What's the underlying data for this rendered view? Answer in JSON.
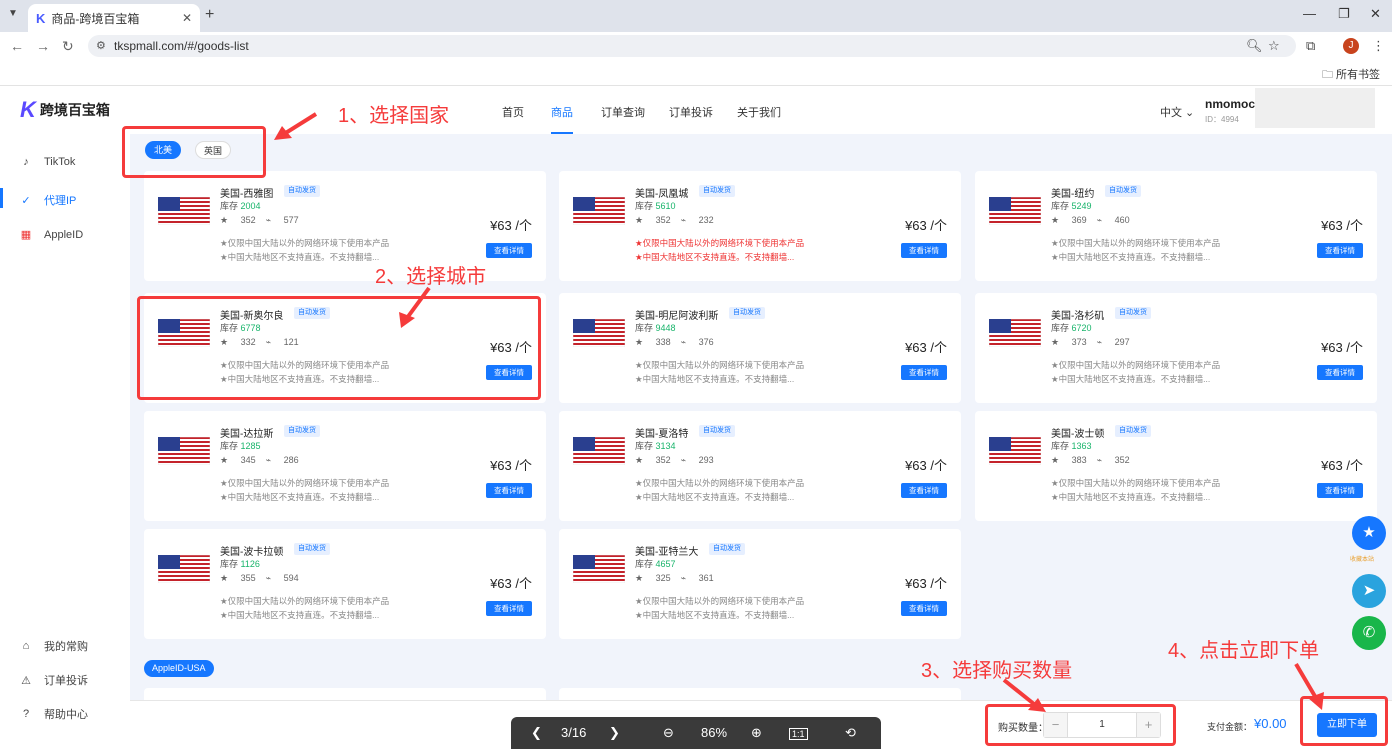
{
  "browser": {
    "tab_title": "商品-跨境百宝箱",
    "url": "tkspmall.com/#/goods-list",
    "bookmarks_label": "所有书签",
    "profile_initial": "J"
  },
  "header": {
    "brand": "跨境百宝箱",
    "nav": [
      "首页",
      "商品",
      "订单查询",
      "订单投诉",
      "关于我们"
    ],
    "lang": "中文 ⌄",
    "username": "nmomocq",
    "user_id": "ID：4994"
  },
  "sidebar": {
    "items": [
      "TikTok",
      "代理IP",
      "AppleID"
    ],
    "bottom_items": [
      "我的常购",
      "订单投诉",
      "帮助中心"
    ]
  },
  "filters": {
    "regions": [
      "北美",
      "英国"
    ]
  },
  "cards": [
    {
      "title": "美国-西雅图",
      "tag": "自动发货",
      "stock_label": "库存",
      "stock": "2004",
      "stars": "352",
      "links": "577",
      "price": "¥63 /个",
      "note1": "★仅限中国大陆以外的网络环境下使用本产品",
      "note2": "★中国大陆地区不支持直连。不支持翻墙...",
      "btn": "查看详情"
    },
    {
      "title": "美国-凤凰城",
      "tag": "自动发货",
      "stock_label": "库存",
      "stock": "5610",
      "stars": "352",
      "links": "232",
      "price": "¥63 /个",
      "note1": "★仅限中国大陆以外的网络环境下使用本产品",
      "note2": "★中国大陆地区不支持直连。不支持翻墙...",
      "btn": "查看详情"
    },
    {
      "title": "美国-纽约",
      "tag": "自动发货",
      "stock_label": "库存",
      "stock": "5249",
      "stars": "369",
      "links": "460",
      "price": "¥63 /个",
      "note1": "★仅限中国大陆以外的网络环境下使用本产品",
      "note2": "★中国大陆地区不支持直连。不支持翻墙...",
      "btn": "查看详情"
    },
    {
      "title": "美国-新奥尔良",
      "tag": "自动发货",
      "stock_label": "库存",
      "stock": "6778",
      "stars": "332",
      "links": "121",
      "price": "¥63 /个",
      "note1": "★仅限中国大陆以外的网络环境下使用本产品",
      "note2": "★中国大陆地区不支持直连。不支持翻墙...",
      "btn": "查看详情"
    },
    {
      "title": "美国-明尼阿波利斯",
      "tag": "自动发货",
      "stock_label": "库存",
      "stock": "9448",
      "stars": "338",
      "links": "376",
      "price": "¥63 /个",
      "note1": "★仅限中国大陆以外的网络环境下使用本产品",
      "note2": "★中国大陆地区不支持直连。不支持翻墙...",
      "btn": "查看详情"
    },
    {
      "title": "美国-洛杉矶",
      "tag": "自动发货",
      "stock_label": "库存",
      "stock": "6720",
      "stars": "373",
      "links": "297",
      "price": "¥63 /个",
      "note1": "★仅限中国大陆以外的网络环境下使用本产品",
      "note2": "★中国大陆地区不支持直连。不支持翻墙...",
      "btn": "查看详情"
    },
    {
      "title": "美国-达拉斯",
      "tag": "自动发货",
      "stock_label": "库存",
      "stock": "1285",
      "stars": "345",
      "links": "286",
      "price": "¥63 /个",
      "note1": "★仅限中国大陆以外的网络环境下使用本产品",
      "note2": "★中国大陆地区不支持直连。不支持翻墙...",
      "btn": "查看详情"
    },
    {
      "title": "美国-夏洛特",
      "tag": "自动发货",
      "stock_label": "库存",
      "stock": "3134",
      "stars": "352",
      "links": "293",
      "price": "¥63 /个",
      "note1": "★仅限中国大陆以外的网络环境下使用本产品",
      "note2": "★中国大陆地区不支持直连。不支持翻墙...",
      "btn": "查看详情"
    },
    {
      "title": "美国-波士顿",
      "tag": "自动发货",
      "stock_label": "库存",
      "stock": "1363",
      "stars": "383",
      "links": "352",
      "price": "¥63 /个",
      "note1": "★仅限中国大陆以外的网络环境下使用本产品",
      "note2": "★中国大陆地区不支持直连。不支持翻墙...",
      "btn": "查看详情"
    },
    {
      "title": "美国-波卡拉顿",
      "tag": "自动发货",
      "stock_label": "库存",
      "stock": "1126",
      "stars": "355",
      "links": "594",
      "price": "¥63 /个",
      "note1": "★仅限中国大陆以外的网络环境下使用本产品",
      "note2": "★中国大陆地区不支持直连。不支持翻墙...",
      "btn": "查看详情"
    },
    {
      "title": "美国-亚特兰大",
      "tag": "自动发货",
      "stock_label": "库存",
      "stock": "4657",
      "stars": "325",
      "links": "361",
      "price": "¥63 /个",
      "note1": "★仅限中国大陆以外的网络环境下使用本产品",
      "note2": "★中国大陆地区不支持直连。不支持翻墙...",
      "btn": "查看详情"
    }
  ],
  "section2": "AppleID-USA",
  "floating": {
    "collect_label": "收藏本站"
  },
  "order": {
    "qty_label": "购买数量：",
    "qty_value": "1",
    "minus": "−",
    "plus": "+",
    "pay_label": "支付金额：",
    "pay_value": "¥0.00",
    "submit": "立即下单"
  },
  "viewer": {
    "page": "3/16",
    "zoom": "86%"
  },
  "annotations": {
    "step1": "1、选择国家",
    "step2": "2、选择城市",
    "step3": "3、选择购买数量",
    "step4": "4、点击立即下单"
  },
  "colors": {
    "accent": "#1677ff",
    "annotation": "#f53b3b",
    "stock": "#19b46b"
  }
}
